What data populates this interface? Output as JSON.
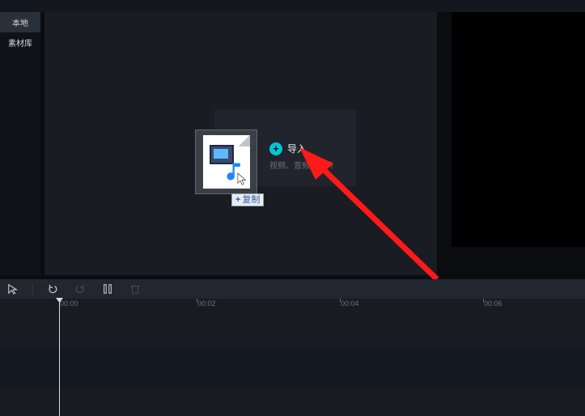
{
  "menu": {
    "items": [
      "",
      "",
      "",
      "",
      ""
    ]
  },
  "sidebar": {
    "items": [
      {
        "label": "本地"
      },
      {
        "label": "素材库"
      }
    ]
  },
  "import": {
    "label": "导入",
    "subtext": "视频、音频、图片"
  },
  "drag": {
    "badge_plus": "+",
    "badge_label": "复制"
  },
  "timeline": {
    "labels": [
      "00:00",
      "00:02",
      "00:04",
      "00:06"
    ]
  },
  "colors": {
    "accent": "#00c8d6",
    "arrow": "#ff1a1a"
  }
}
